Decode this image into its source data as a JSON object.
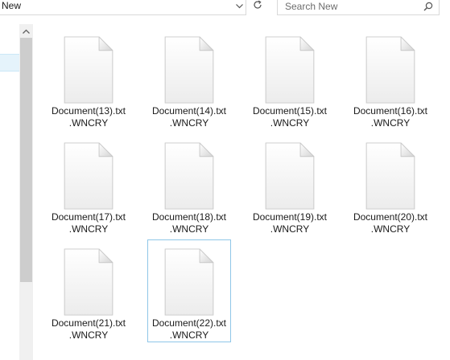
{
  "address_bar": {
    "path": "New"
  },
  "search": {
    "placeholder": "Search New"
  },
  "files": [
    {
      "line1": "Document(13).txt",
      "line2": ".WNCRY"
    },
    {
      "line1": "Document(14).txt",
      "line2": ".WNCRY"
    },
    {
      "line1": "Document(15).txt",
      "line2": ".WNCRY"
    },
    {
      "line1": "Document(16).txt",
      "line2": ".WNCRY"
    },
    {
      "line1": "Document(17).txt",
      "line2": ".WNCRY"
    },
    {
      "line1": "Document(18).txt",
      "line2": ".WNCRY"
    },
    {
      "line1": "Document(19).txt",
      "line2": ".WNCRY"
    },
    {
      "line1": "Document(20).txt",
      "line2": ".WNCRY"
    },
    {
      "line1": "Document(21).txt",
      "line2": ".WNCRY"
    },
    {
      "line1": "Document(22).txt",
      "line2": ".WNCRY",
      "selected": true
    }
  ],
  "icons": {
    "address_dropdown": "chevron-down-icon",
    "refresh": "refresh-icon",
    "search": "search-icon",
    "scroll_up": "scroll-up-arrow-icon",
    "file": "blank-file-icon"
  },
  "colors": {
    "selection_border": "#8fc6e8",
    "nav_selection": "#e5f3fb"
  }
}
